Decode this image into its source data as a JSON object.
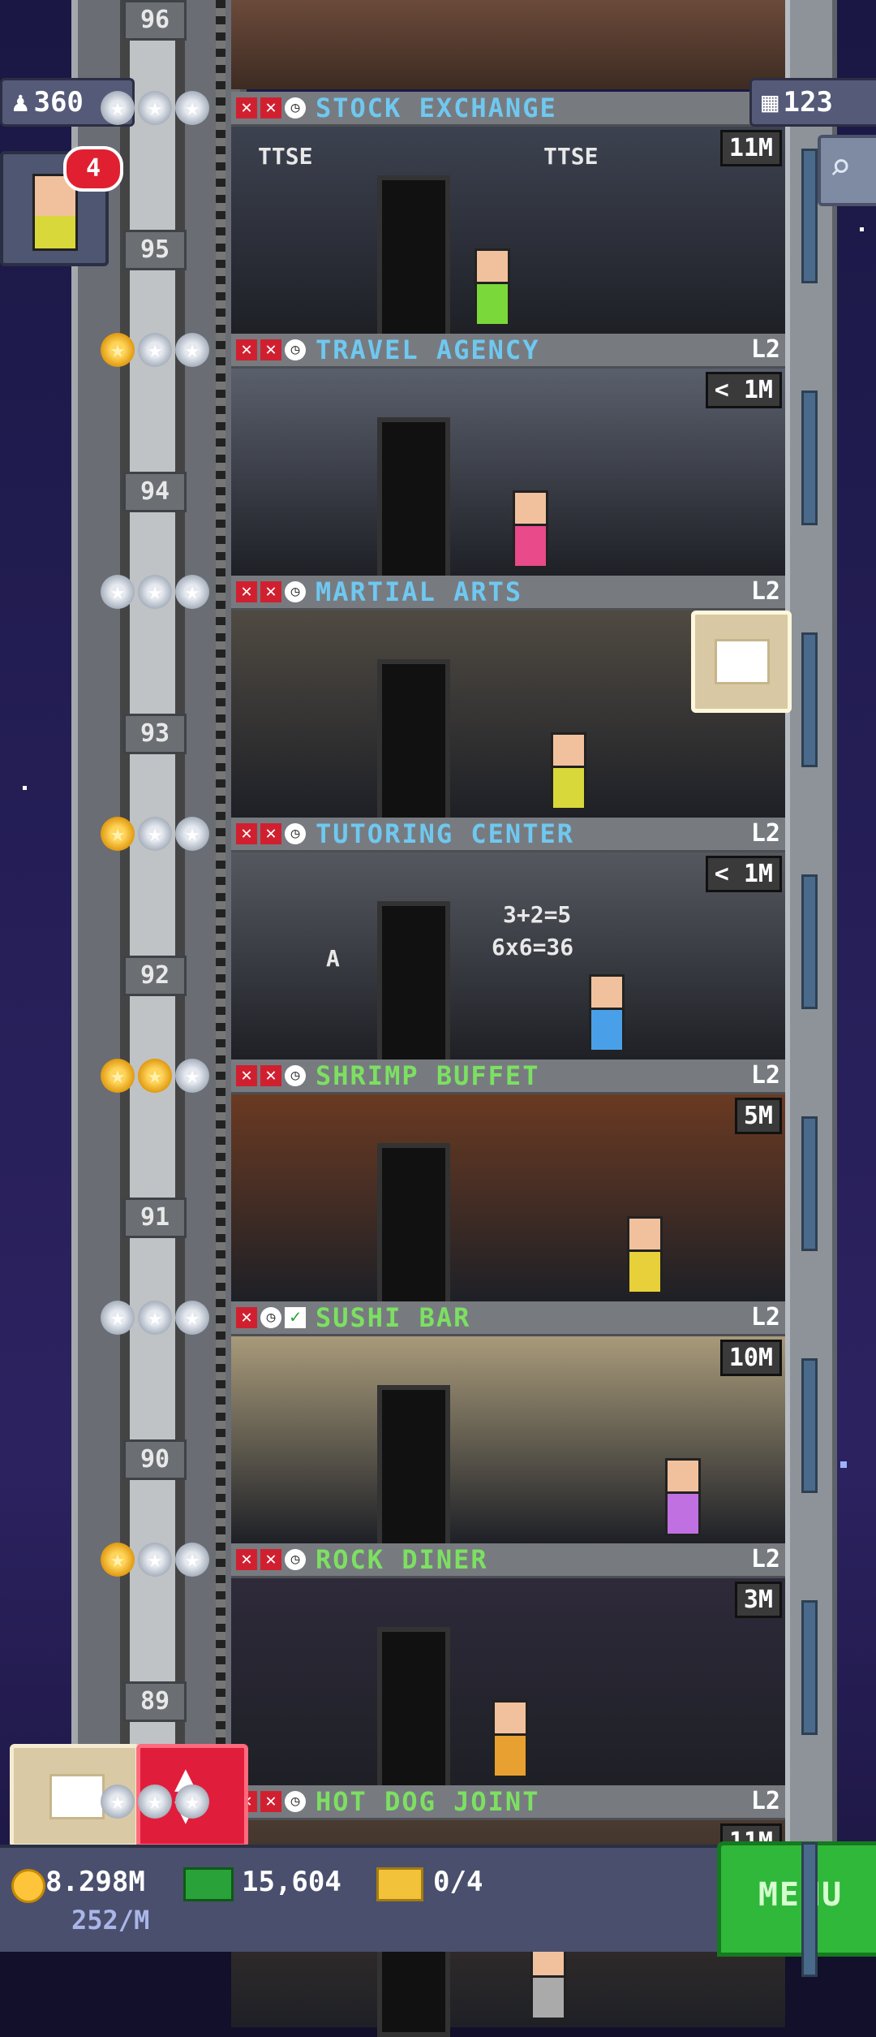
{
  "hud": {
    "population": "360",
    "floors": "123",
    "notifications": "4"
  },
  "floors": [
    {
      "name": "STOCK EXCHANGE",
      "level": "",
      "badge": "11M",
      "num": "95",
      "name_color": "#6fc8f0",
      "stars": [
        0,
        0,
        0
      ],
      "icons": [
        "x",
        "x",
        "clock"
      ]
    },
    {
      "name": "TRAVEL AGENCY",
      "level": "L2",
      "badge": "< 1M",
      "num": "94",
      "name_color": "#6fc8f0",
      "stars": [
        1,
        0,
        0
      ],
      "icons": [
        "x",
        "x",
        "clock"
      ]
    },
    {
      "name": "MARTIAL ARTS",
      "level": "L2",
      "badge": "",
      "num": "93",
      "name_color": "#6fc8f0",
      "stars": [
        0,
        0,
        0
      ],
      "icons": [
        "x",
        "x",
        "clock"
      ]
    },
    {
      "name": "TUTORING CENTER",
      "level": "L2",
      "badge": "< 1M",
      "num": "92",
      "name_color": "#6fc8f0",
      "stars": [
        1,
        0,
        0
      ],
      "icons": [
        "x",
        "x",
        "clock"
      ]
    },
    {
      "name": "SHRIMP BUFFET",
      "level": "L2",
      "badge": "5M",
      "num": "91",
      "name_color": "#7ce061",
      "stars": [
        1,
        1,
        0
      ],
      "icons": [
        "x",
        "x",
        "clock"
      ]
    },
    {
      "name": "SUSHI BAR",
      "level": "L2",
      "badge": "10M",
      "num": "90",
      "name_color": "#7ce061",
      "stars": [
        0,
        0,
        0
      ],
      "icons": [
        "x",
        "clock",
        "check"
      ]
    },
    {
      "name": "ROCK DINER",
      "level": "L2",
      "badge": "3M",
      "num": "89",
      "name_color": "#7ce061",
      "stars": [
        1,
        0,
        0
      ],
      "icons": [
        "x",
        "x",
        "clock"
      ]
    },
    {
      "name": "HOT DOG JOINT",
      "level": "L2",
      "badge": "11M",
      "num": "",
      "name_color": "#7ce061",
      "stars": [
        0,
        0,
        0
      ],
      "icons": [
        "x",
        "x",
        "clock"
      ]
    }
  ],
  "top_floor_num": "96",
  "room_text": {
    "ttse_left": "TTSE",
    "ttse_right": "TTSE",
    "chalk_line1": "3+2=5",
    "chalk_line2": "6x6=36",
    "poster_letter": "A"
  },
  "bottom": {
    "coins": "8.298M",
    "rate": "252/M",
    "bux": "15,604",
    "tickets": "0/4",
    "menu_label": "MENU"
  },
  "colors": {
    "tower_gray": "#777b80",
    "menu_green": "#2fb83a",
    "elevator_red": "#e01e3c"
  }
}
